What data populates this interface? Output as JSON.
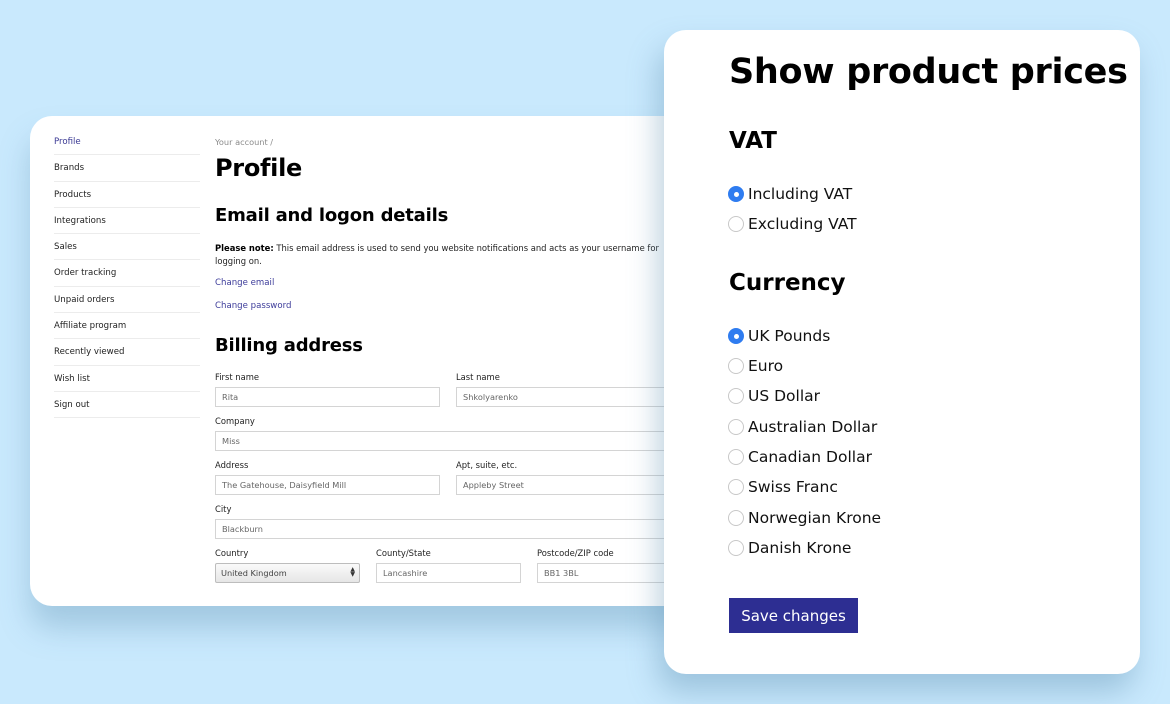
{
  "account": {
    "sidebar": {
      "items": [
        {
          "label": "Profile",
          "active": true
        },
        {
          "label": "Brands"
        },
        {
          "label": "Products"
        },
        {
          "label": "Integrations"
        },
        {
          "label": "Sales"
        },
        {
          "label": "Order tracking"
        },
        {
          "label": "Unpaid orders"
        },
        {
          "label": "Affiliate program"
        },
        {
          "label": "Recently viewed"
        },
        {
          "label": "Wish list"
        },
        {
          "label": "Sign out"
        }
      ]
    },
    "breadcrumb": "Your account /",
    "page_title": "Profile",
    "email_section": {
      "title": "Email and logon details",
      "note_bold": "Please note:",
      "note_text": " This email address is used to send you website notifications and acts as your username for logging on.",
      "change_email": "Change email",
      "change_password": "Change password"
    },
    "billing": {
      "title": "Billing address",
      "first_name": {
        "label": "First name",
        "value": "Rita"
      },
      "last_name": {
        "label": "Last name",
        "value": "Shkolyarenko"
      },
      "company": {
        "label": "Company",
        "value": "Miss"
      },
      "address": {
        "label": "Address",
        "value": "The Gatehouse, Daisyfield Mill"
      },
      "apt": {
        "label": "Apt, suite, etc.",
        "value": "Appleby Street"
      },
      "city": {
        "label": "City",
        "value": "Blackburn"
      },
      "country": {
        "label": "Country",
        "value": "United Kingdom"
      },
      "county": {
        "label": "County/State",
        "value": "Lancashire"
      },
      "postcode": {
        "label": "Postcode/ZIP code",
        "value": "BB1 3BL"
      }
    }
  },
  "prices": {
    "title": "Show product prices",
    "vat": {
      "title": "VAT",
      "options": [
        {
          "label": "Including VAT",
          "checked": true
        },
        {
          "label": "Excluding VAT",
          "checked": false
        }
      ]
    },
    "currency": {
      "title": "Currency",
      "options": [
        {
          "label": "UK Pounds",
          "checked": true
        },
        {
          "label": "Euro",
          "checked": false
        },
        {
          "label": "US Dollar",
          "checked": false
        },
        {
          "label": "Australian Dollar",
          "checked": false
        },
        {
          "label": "Canadian Dollar",
          "checked": false
        },
        {
          "label": "Swiss Franc",
          "checked": false
        },
        {
          "label": "Norwegian Krone",
          "checked": false
        },
        {
          "label": "Danish Krone",
          "checked": false
        }
      ]
    },
    "save_label": "Save changes"
  },
  "colors": {
    "background": "#c9e9fd",
    "accent": "#2d2e92",
    "radio_checked": "#2f7cf0",
    "link": "#3d3c9a"
  }
}
